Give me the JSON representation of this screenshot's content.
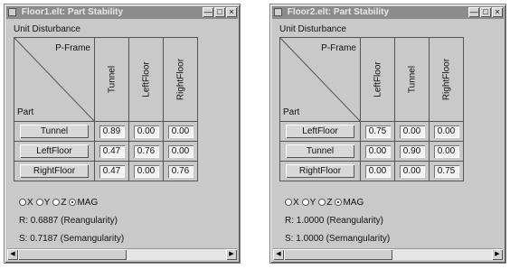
{
  "windows": [
    {
      "title": "Floor1.elt: Part Stability",
      "section_label": "Unit Disturbance",
      "corner_top": "P-Frame",
      "corner_bottom": "Part",
      "columns": [
        "Tunnel",
        "LeftFloor",
        "RightFloor"
      ],
      "rows": [
        {
          "label": "Tunnel",
          "values": [
            "0.89",
            "0.00",
            "0.00"
          ]
        },
        {
          "label": "LeftFloor",
          "values": [
            "0.47",
            "0.76",
            "0.00"
          ]
        },
        {
          "label": "RightFloor",
          "values": [
            "0.47",
            "0.00",
            "0.76"
          ]
        }
      ],
      "radio_options": [
        "X",
        "Y",
        "Z",
        "MAG"
      ],
      "radio_selected": "MAG",
      "r_text": "R: 0.6887 (Reangularity)",
      "s_text": "S: 0.7187 (Semangularity)"
    },
    {
      "title": "Floor2.elt: Part Stability",
      "section_label": "Unit Disturbance",
      "corner_top": "P-Frame",
      "corner_bottom": "Part",
      "columns": [
        "LeftFloor",
        "Tunnel",
        "RightFloor"
      ],
      "rows": [
        {
          "label": "LeftFloor",
          "values": [
            "0.75",
            "0.00",
            "0.00"
          ]
        },
        {
          "label": "Tunnel",
          "values": [
            "0.00",
            "0.90",
            "0.00"
          ]
        },
        {
          "label": "RightFloor",
          "values": [
            "0.00",
            "0.00",
            "0.75"
          ]
        }
      ],
      "radio_options": [
        "X",
        "Y",
        "Z",
        "MAG"
      ],
      "radio_selected": "MAG",
      "r_text": "R: 1.0000 (Reangularity)",
      "s_text": "S: 1.0000 (Semangularity)"
    }
  ],
  "titlebar_buttons": [
    "minimize-icon",
    "maximize-icon",
    "close-icon"
  ],
  "colors": {
    "window_bg": "#c9c9c9",
    "titlebar_bg": "#8c8c8c"
  }
}
